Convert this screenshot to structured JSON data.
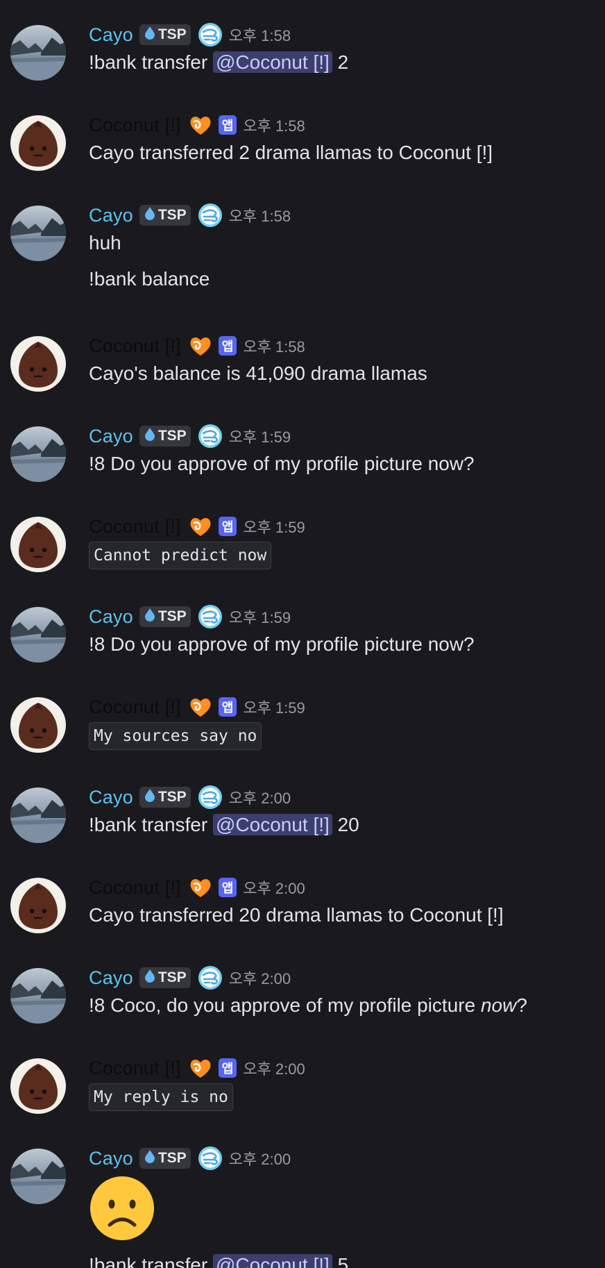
{
  "cayo_name": "Cayo",
  "coco_name": "Coconut [!]",
  "cayo_tag": "TSP",
  "app_label": "앱",
  "messages": [
    {
      "author": "cayo",
      "time": "오후 1:58",
      "lines": [
        {
          "pre": "!bank transfer ",
          "mention": "@Coconut [!]",
          "post": " 2"
        }
      ]
    },
    {
      "author": "coco",
      "time": "오후 1:58",
      "lines": [
        {
          "text": "Cayo transferred 2 drama llamas to Coconut [!]"
        }
      ]
    },
    {
      "author": "cayo",
      "time": "오후 1:58",
      "lines": [
        {
          "text": "huh"
        },
        {
          "text": "!bank balance"
        }
      ]
    },
    {
      "author": "coco",
      "time": "오후 1:58",
      "lines": [
        {
          "text": "Cayo's balance is 41,090 drama llamas"
        }
      ]
    },
    {
      "author": "cayo",
      "time": "오후 1:59",
      "lines": [
        {
          "text": "!8 Do you approve of my profile picture now?"
        }
      ]
    },
    {
      "author": "coco",
      "time": "오후 1:59",
      "lines": [
        {
          "code": "Cannot predict now"
        }
      ]
    },
    {
      "author": "cayo",
      "time": "오후 1:59",
      "lines": [
        {
          "text": "!8 Do you approve of my profile picture now?"
        }
      ]
    },
    {
      "author": "coco",
      "time": "오후 1:59",
      "lines": [
        {
          "code": "My sources say no"
        }
      ]
    },
    {
      "author": "cayo",
      "time": "오후 2:00",
      "lines": [
        {
          "pre": "!bank transfer ",
          "mention": "@Coconut [!]",
          "post": "  20"
        }
      ]
    },
    {
      "author": "coco",
      "time": "오후 2:00",
      "lines": [
        {
          "text": "Cayo transferred 20 drama llamas to Coconut [!]"
        }
      ]
    },
    {
      "author": "cayo",
      "time": "오후 2:00",
      "lines": [
        {
          "pre": "!8 Coco, do you approve of my profile picture ",
          "em": "now",
          "post": "?"
        }
      ]
    },
    {
      "author": "coco",
      "time": "오후 2:00",
      "lines": [
        {
          "code": "My reply is no"
        }
      ]
    },
    {
      "author": "cayo",
      "time": "오후 2:00",
      "emoji": "frowning-face",
      "lines": [
        {
          "pre": "!bank transfer ",
          "mention": "@Coconut [!]",
          "post": "  5"
        }
      ]
    }
  ],
  "colors": {
    "background": "#1a1a1e",
    "cayo": "#5ec3ef",
    "mention_bg": "#3c3f6d",
    "app_badge": "#5865f2"
  }
}
